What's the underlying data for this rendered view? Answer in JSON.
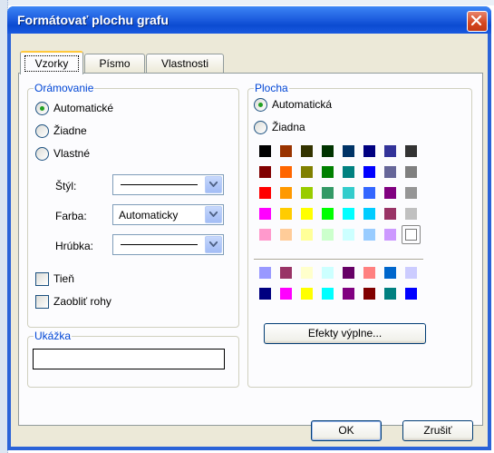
{
  "window": {
    "title": "Formátovať plochu grafu"
  },
  "tabs": [
    {
      "label": "Vzorky",
      "active": true
    },
    {
      "label": "Písmo",
      "active": false
    },
    {
      "label": "Vlastnosti",
      "active": false
    }
  ],
  "border_group": {
    "title": "Orámovanie",
    "options": [
      {
        "label": "Automatické",
        "checked": true
      },
      {
        "label": "Žiadne",
        "checked": false
      },
      {
        "label": "Vlastné",
        "checked": false
      }
    ],
    "style_label": "Štýl:",
    "color_label": "Farba:",
    "color_value": "Automaticky",
    "weight_label": "Hrúbka:",
    "shadow_label": "Tieň",
    "round_corners_label": "Zaobliť rohy"
  },
  "preview_group": {
    "title": "Ukážka"
  },
  "area_group": {
    "title": "Plocha",
    "options": [
      {
        "label": "Automatická",
        "checked": true
      },
      {
        "label": "Žiadna",
        "checked": false
      }
    ],
    "palette_main": [
      [
        "#000000",
        "#993300",
        "#333300",
        "#003300",
        "#003366",
        "#000080",
        "#333399",
        "#333333"
      ],
      [
        "#800000",
        "#ff6600",
        "#808000",
        "#008000",
        "#008080",
        "#0000ff",
        "#666699",
        "#808080"
      ],
      [
        "#ff0000",
        "#ff9900",
        "#99cc00",
        "#339966",
        "#33cccc",
        "#3366ff",
        "#800080",
        "#969696"
      ],
      [
        "#ff00ff",
        "#ffcc00",
        "#ffff00",
        "#00ff00",
        "#00ffff",
        "#00ccff",
        "#993366",
        "#c0c0c0"
      ],
      [
        "#ff99cc",
        "#ffcc99",
        "#ffff99",
        "#ccffcc",
        "#ccffff",
        "#99ccff",
        "#cc99ff",
        "#ffffff"
      ]
    ],
    "palette_chart": [
      [
        "#9999ff",
        "#993366",
        "#ffffcc",
        "#ccffff",
        "#660066",
        "#ff8080",
        "#0066cc",
        "#ccccff"
      ],
      [
        "#000080",
        "#ff00ff",
        "#ffff00",
        "#00ffff",
        "#800080",
        "#800000",
        "#008080",
        "#0000ff"
      ]
    ],
    "fill_effects_label": "Efekty výplne..."
  },
  "buttons": {
    "ok": "OK",
    "cancel": "Zrušiť"
  }
}
